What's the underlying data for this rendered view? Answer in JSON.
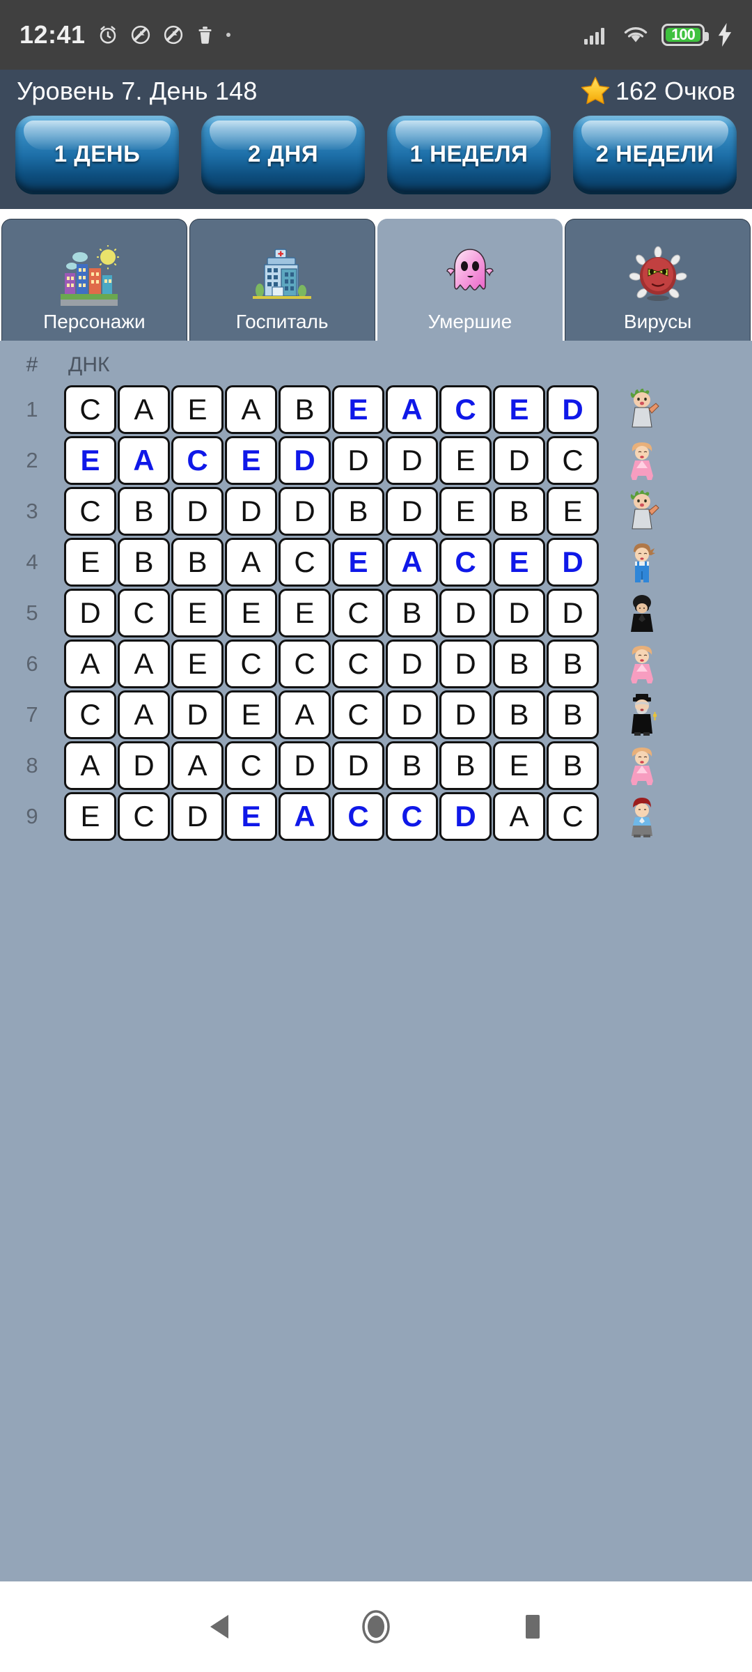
{
  "statusbar": {
    "clock": "12:41",
    "battery_level": "100",
    "icons": [
      "alarm-icon",
      "do-not-disturb-icon",
      "do-not-disturb-icon",
      "trash-icon",
      "dot-icon"
    ],
    "right_icons": [
      "signal-icon",
      "wifi-icon",
      "battery-icon",
      "charging-bolt-icon"
    ]
  },
  "header": {
    "title": "Уровень 7. День 148",
    "score": "162 Очков",
    "star_icon": "star-icon",
    "star_color": "#f5c518"
  },
  "period_buttons": [
    {
      "label": "1 ДЕНЬ"
    },
    {
      "label": "2 ДНЯ"
    },
    {
      "label": "1 НЕДЕЛЯ"
    },
    {
      "label": "2 НЕДЕЛИ"
    }
  ],
  "tabs": [
    {
      "label": "Персонажи",
      "icon": "city-icon",
      "active": false
    },
    {
      "label": "Госпиталь",
      "icon": "hospital-icon",
      "active": false
    },
    {
      "label": "Умершие",
      "icon": "ghost-icon",
      "active": true
    },
    {
      "label": "Вирусы",
      "icon": "virus-icon",
      "active": false
    }
  ],
  "table": {
    "header_num": "#",
    "header_dna": "ДНК",
    "highlight_color": "#0f18e8",
    "rows": [
      {
        "num": "1",
        "dna": [
          "C",
          "A",
          "E",
          "A",
          "B",
          "E",
          "A",
          "C",
          "E",
          "D"
        ],
        "hl": [
          false,
          false,
          false,
          false,
          false,
          true,
          true,
          true,
          true,
          true
        ],
        "avatar": "baby-green-hair-icon"
      },
      {
        "num": "2",
        "dna": [
          "E",
          "A",
          "C",
          "E",
          "D",
          "D",
          "D",
          "E",
          "D",
          "C"
        ],
        "hl": [
          true,
          true,
          true,
          true,
          true,
          false,
          false,
          false,
          false,
          false
        ],
        "avatar": "woman-pink-dress-icon"
      },
      {
        "num": "3",
        "dna": [
          "C",
          "B",
          "D",
          "D",
          "D",
          "B",
          "D",
          "E",
          "B",
          "E"
        ],
        "hl": [
          false,
          false,
          false,
          false,
          false,
          false,
          false,
          false,
          false,
          false
        ],
        "avatar": "baby-green-hair-icon"
      },
      {
        "num": "4",
        "dna": [
          "E",
          "B",
          "B",
          "A",
          "C",
          "E",
          "A",
          "C",
          "E",
          "D"
        ],
        "hl": [
          false,
          false,
          false,
          false,
          false,
          true,
          true,
          true,
          true,
          true
        ],
        "avatar": "girl-overalls-icon"
      },
      {
        "num": "5",
        "dna": [
          "D",
          "C",
          "E",
          "E",
          "E",
          "C",
          "B",
          "D",
          "D",
          "D"
        ],
        "hl": [
          false,
          false,
          false,
          false,
          false,
          false,
          false,
          false,
          false,
          false
        ],
        "avatar": "man-black-suit-icon"
      },
      {
        "num": "6",
        "dna": [
          "A",
          "A",
          "E",
          "C",
          "C",
          "C",
          "D",
          "D",
          "B",
          "B"
        ],
        "hl": [
          false,
          false,
          false,
          false,
          false,
          false,
          false,
          false,
          false,
          false
        ],
        "avatar": "woman-pink-dress-icon"
      },
      {
        "num": "7",
        "dna": [
          "C",
          "A",
          "D",
          "E",
          "A",
          "C",
          "D",
          "D",
          "B",
          "B"
        ],
        "hl": [
          false,
          false,
          false,
          false,
          false,
          false,
          false,
          false,
          false,
          false
        ],
        "avatar": "priest-icon"
      },
      {
        "num": "8",
        "dna": [
          "A",
          "D",
          "A",
          "C",
          "D",
          "D",
          "B",
          "B",
          "E",
          "B"
        ],
        "hl": [
          false,
          false,
          false,
          false,
          false,
          false,
          false,
          false,
          false,
          false
        ],
        "avatar": "woman-pink-dress-icon"
      },
      {
        "num": "9",
        "dna": [
          "E",
          "C",
          "D",
          "E",
          "A",
          "C",
          "C",
          "D",
          "A",
          "C"
        ],
        "hl": [
          false,
          false,
          false,
          true,
          true,
          true,
          true,
          true,
          false,
          false
        ],
        "avatar": "man-red-hair-icon"
      }
    ]
  },
  "navbar": {
    "items": [
      {
        "icon": "back-triangle-icon"
      },
      {
        "icon": "home-circle-icon"
      },
      {
        "icon": "recents-square-icon"
      }
    ]
  }
}
